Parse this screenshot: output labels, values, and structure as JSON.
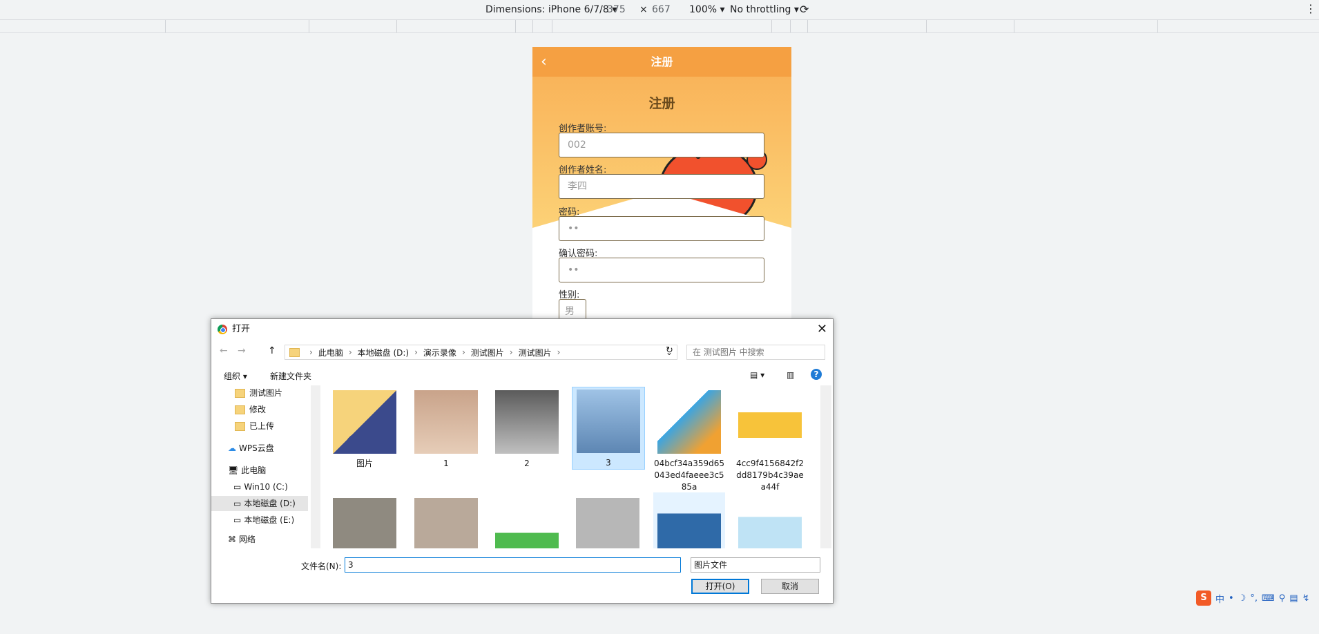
{
  "devtools": {
    "dimensions_label": "Dimensions: iPhone 6/7/8 ▾",
    "width": "375",
    "times": "×",
    "height": "667",
    "zoom": "100% ▾",
    "throttling": "No throttling ▾",
    "menu_icon": "kebab-icon"
  },
  "phone": {
    "nav_title": "注册",
    "back_symbol": "‹",
    "heading": "注册",
    "fields": [
      {
        "label": "创作者账号:",
        "value": "002"
      },
      {
        "label": "创作者姓名:",
        "value": "李四"
      },
      {
        "label": "密码:",
        "value": "••"
      },
      {
        "label": "确认密码:",
        "value": "••"
      }
    ],
    "gender_label": "性别:",
    "gender_value": "男"
  },
  "dialog": {
    "title": "打开",
    "close": "✕",
    "path": [
      "此电脑",
      "本地磁盘 (D:)",
      "演示录像",
      "测试图片",
      "测试图片"
    ],
    "search_placeholder": "在 测试图片 中搜索",
    "organize": "组织 ▾",
    "new_folder": "新建文件夹",
    "tree": [
      {
        "label": "测试图片",
        "kind": "folder"
      },
      {
        "label": "修改",
        "kind": "folder"
      },
      {
        "label": "已上传",
        "kind": "folder"
      },
      {
        "label": "WPS云盘",
        "kind": "cloud"
      },
      {
        "label": "此电脑",
        "kind": "pc"
      },
      {
        "label": "Win10 (C:)",
        "kind": "drive"
      },
      {
        "label": "本地磁盘 (D:)",
        "kind": "drive",
        "selected": true
      },
      {
        "label": "本地磁盘 (E:)",
        "kind": "drive"
      },
      {
        "label": "网络",
        "kind": "network"
      }
    ],
    "files_row1": [
      {
        "label": "图片"
      },
      {
        "label": "1"
      },
      {
        "label": "2"
      },
      {
        "label": "3",
        "selected": true
      },
      {
        "label": "04bcf34a359d65043ed4faeee3c585a"
      },
      {
        "label": "4cc9f4156842f2dd8179b4c39aea44f"
      }
    ],
    "filename_label": "文件名(N):",
    "filename_value": "3",
    "filetype": "图片文件",
    "open_button": "打开(O)",
    "cancel_button": "取消"
  },
  "ime": {
    "logo": "S",
    "items": [
      "中",
      "•",
      "☽",
      "°,",
      "⌨",
      "⚲",
      "▤",
      "↯"
    ]
  },
  "colors": {
    "nav": "#f5a042",
    "hero_top": "#f9b45a",
    "hero_bottom": "#fcd479",
    "selection": "#cce8ff",
    "accent": "#0078d7"
  }
}
